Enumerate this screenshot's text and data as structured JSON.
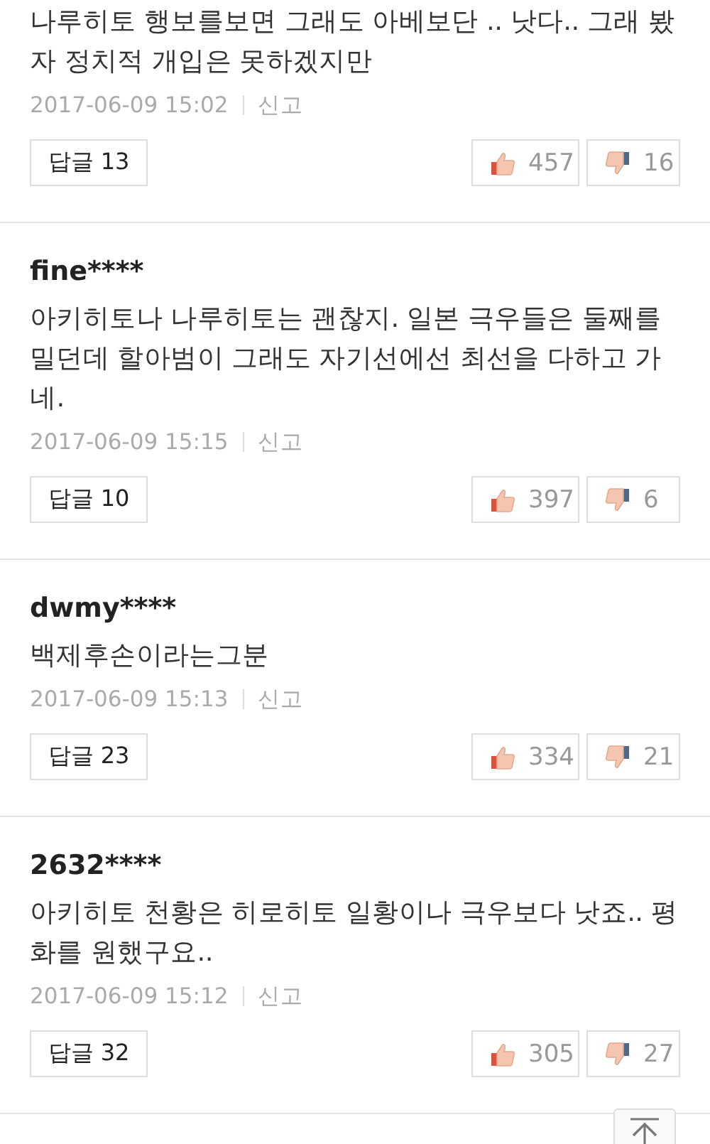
{
  "comments": [
    {
      "text": "나루히토 행보를보면 그래도 아베보단 .. 낫다.. 그래 봤자 정치적 개입은 못하겠지만",
      "date": "2017-06-09 15:02",
      "report": "신고",
      "replies": "답글 13",
      "likes": "457",
      "dislikes": "16"
    },
    {
      "author": "fine****",
      "text": "아키히토나 나루히토는 괜찮지. 일본 극우들은 둘째를 밀던데 할아범이 그래도 자기선에선 최선을 다하고 가네.",
      "date": "2017-06-09 15:15",
      "report": "신고",
      "replies": "답글 10",
      "likes": "397",
      "dislikes": "6"
    },
    {
      "author": "dwmy****",
      "text": "백제후손이라는그분",
      "date": "2017-06-09 15:13",
      "report": "신고",
      "replies": "답글 23",
      "likes": "334",
      "dislikes": "21"
    },
    {
      "author": "2632****",
      "text": "아키히토 천황은 히로히토 일황이나 극우보다 낫죠.. 평화를 원했구요..",
      "date": "2017-06-09 15:12",
      "report": "신고",
      "replies": "답글 32",
      "likes": "305",
      "dislikes": "27"
    }
  ]
}
